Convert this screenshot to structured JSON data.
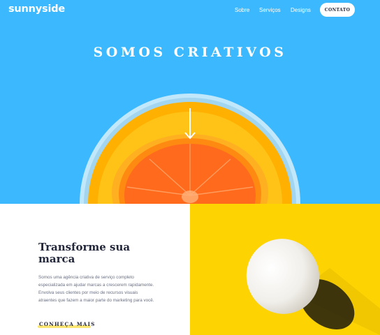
{
  "header": {
    "logo": "sunnyside",
    "nav": [
      "Sobre",
      "Serviços",
      "Designs"
    ],
    "contact_button": "CONTATO"
  },
  "hero": {
    "title": "SOMOS CRIATIVOS",
    "arrow_icon": "arrow-down-icon"
  },
  "feature": {
    "title": "Transforme sua marca",
    "body": "Somos uma agência criativa de serviço completo especializada em ajudar marcas a crescerem rapidamente. Envolva seus clientes por meio de recursos visuais atraentes que fazem a maior parte do marketing para você.",
    "link": "CONHEÇA MAIS"
  },
  "colors": {
    "hero_bg": "#3cb9fe",
    "egg_bg": "#fdd302",
    "heading": "#24283b",
    "body_text": "#6b7184",
    "accent_underline": "#fad400"
  }
}
